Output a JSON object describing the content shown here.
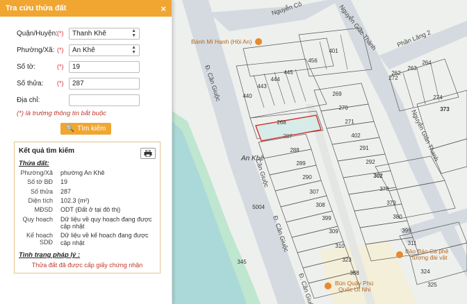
{
  "panel": {
    "title": "Tra cứu thửa đất",
    "close_label": "×",
    "form": {
      "district_label": "Quận/Huyện:",
      "district_value": "Thanh Khê",
      "ward_label": "Phường/Xã:",
      "ward_value": "An Khê",
      "map_sheet_label": "Số tờ:",
      "map_sheet_value": "19",
      "parcel_label": "Số thửa:",
      "parcel_value": "287",
      "address_label": "Địa chỉ:",
      "address_value": "",
      "required_mark": "(*)",
      "required_note": "(*) là trường thông tin bắt buộc",
      "search_label": "Tìm kiếm"
    },
    "result": {
      "title": "Kết quả tìm kiếm",
      "section_parcel": "Thửa đất:",
      "ward_k": "Phường/Xã",
      "ward_v": "phường An Khê",
      "sheet_k": "Số tờ BĐ",
      "sheet_v": "19",
      "parcel_k": "Số thửa",
      "parcel_v": "287",
      "area_k": "Diện tích",
      "area_v": "102.3 (m²)",
      "usage_k": "MĐSD",
      "usage_v": "ODT (Đất ở tại đô thị)",
      "plan_k": "Quy hoạch",
      "plan_v": "Dữ liệu về quy hoạch đang được cập nhật",
      "landuse_k": "Kế hoạch SDĐ",
      "landuse_v": "Dữ liệu về kế hoạch đang được cập nhật",
      "section_legal": "Tình trạng pháp lý :",
      "legal_status": "Thửa đất đã được cấp giấy chứng nhận"
    }
  },
  "map": {
    "streets": {
      "can_giuoc_1": "Đ. Cần Giuộc",
      "can_giuoc_2": "Cần Giuộc",
      "can_giuoc_3": "Đ. Cần Giuộc",
      "can_giuoc_4": "Đ. Cần Giuộc",
      "nguyen_giac_thanh": "Nguyễn Giác Thành",
      "nguyen_giac_thanh_2": "Nguyễn Giản Thanh",
      "phan_lang": "Phần Lăng 2",
      "nguyen_top": "Nguyễn Cô",
      "area_an_khe": "An Khê"
    },
    "pois": {
      "banh_mi": "Bánh Mì Hạnh (Hội An)",
      "bao_bao": "Bảo Bảo Cà phê",
      "bao_bao_2": "tượng đài vật",
      "bun_quay": "Bún Quậy Phú",
      "bun_quay_2": "Quốc Út Nhi"
    },
    "parcels": [
      "401",
      "456",
      "445",
      "444",
      "443",
      "440",
      "269",
      "270",
      "271",
      "402",
      "268",
      "287",
      "288",
      "289",
      "290",
      "307",
      "308",
      "309",
      "310",
      "323",
      "291",
      "292",
      "302",
      "378",
      "379",
      "380",
      "399",
      "311",
      "324",
      "325",
      "388",
      "5004",
      "345",
      "262",
      "263",
      "264",
      "272",
      "274",
      "373"
    ]
  }
}
